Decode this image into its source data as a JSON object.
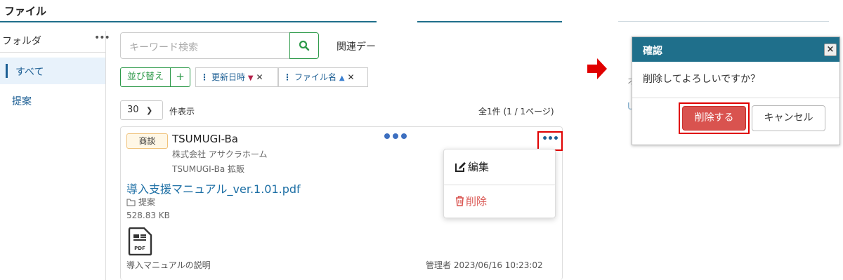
{
  "page": {
    "title": "ファイル"
  },
  "sidebar": {
    "heading": "フォルダ",
    "more": "•••",
    "items": [
      {
        "label": "すべて",
        "active": true
      },
      {
        "label": "提案",
        "active": false
      }
    ]
  },
  "search": {
    "placeholder": "キーワード検索",
    "related_label": "関連デー"
  },
  "sort": {
    "button_label": "並び替え",
    "add_label": "+",
    "chips": [
      {
        "label": "更新日時",
        "direction": "down"
      },
      {
        "label": "ファイル名",
        "direction": "up"
      }
    ]
  },
  "paging": {
    "per_page": "30",
    "per_page_label": "件表示",
    "total": "全1件 (1 / 1ページ)"
  },
  "card": {
    "tag": "商談",
    "title": "TSUMUGI-Ba",
    "company": "株式会社 アサクラホーム",
    "project": "TSUMUGI-Ba 拡販",
    "file_name": "導入支援マニュアル_ver.1.01.pdf",
    "folder": "提案",
    "size": "528.83 KB",
    "file_type": "PDF",
    "description": "導入マニュアルの説明",
    "meta": "管理者 2023/06/16 10:23:02",
    "more": "•••"
  },
  "menu": {
    "edit": "編集",
    "delete": "削除"
  },
  "dialog": {
    "title": "確認",
    "close": "×",
    "message": "削除してよろしいですか？",
    "ok": "削除する",
    "cancel": "キャンセル",
    "behind_1": "オ",
    "behind_2": "U"
  },
  "colors": {
    "accent": "#1f6f8b",
    "danger": "#d9534f",
    "success": "#2e9a4a",
    "highlight": "#e00000",
    "link": "#1d6fa5"
  }
}
